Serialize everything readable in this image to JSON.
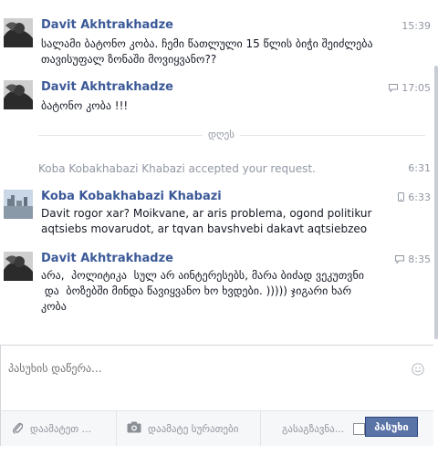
{
  "messages": [
    {
      "sender": "Davit Akhtrakhadze",
      "time": "15:39",
      "text": "სალამი ბატონო კობა. ჩემი წათლული 15 წლის ბიჭი შეიძლება თავისუფალ ზონაში მოვიყვანო??"
    },
    {
      "sender": "Davit Akhtrakhadze",
      "time": "17:05",
      "time_icon": "chat-icon",
      "text": "ბატონო კობა !!!"
    },
    {
      "sender": "Koba Kobakhabazi Khabazi",
      "time": "6:33",
      "time_icon": "mobile-icon",
      "text": "Davit rogor xar? Moikvane, ar aris problema, ogond politikur\naqtsiebs movarudot, ar tqvan bavshvebi dakavt aqtsiebzeo"
    },
    {
      "sender": "Davit Akhtrakhadze",
      "time": "8:35",
      "time_icon": "chat-icon",
      "text": "არა,  პოლიტიკა  სულ არ აინტერესებს, მარა ბიძად ვეკუთვნი\n და  ბოზებში მინდა წავიყვანო ხო ხვდები. ))))) ჯიგარი ხარ\nკობა"
    }
  ],
  "day_divider": "დღეს",
  "system_event": {
    "text": "Koba Kobakhabazi Khabazi accepted your request.",
    "time": "6:31"
  },
  "composer": {
    "placeholder": "პასუხის დაწერა..."
  },
  "toolbar": {
    "attach_file": "დაამატეთ ...",
    "add_photo": "დაამატე სურათები",
    "send_on_enter": "გასაგზავნა...",
    "send_button": "პასუხი"
  },
  "colors": {
    "name": "#3b5998",
    "send_button": "#5b74a8"
  }
}
